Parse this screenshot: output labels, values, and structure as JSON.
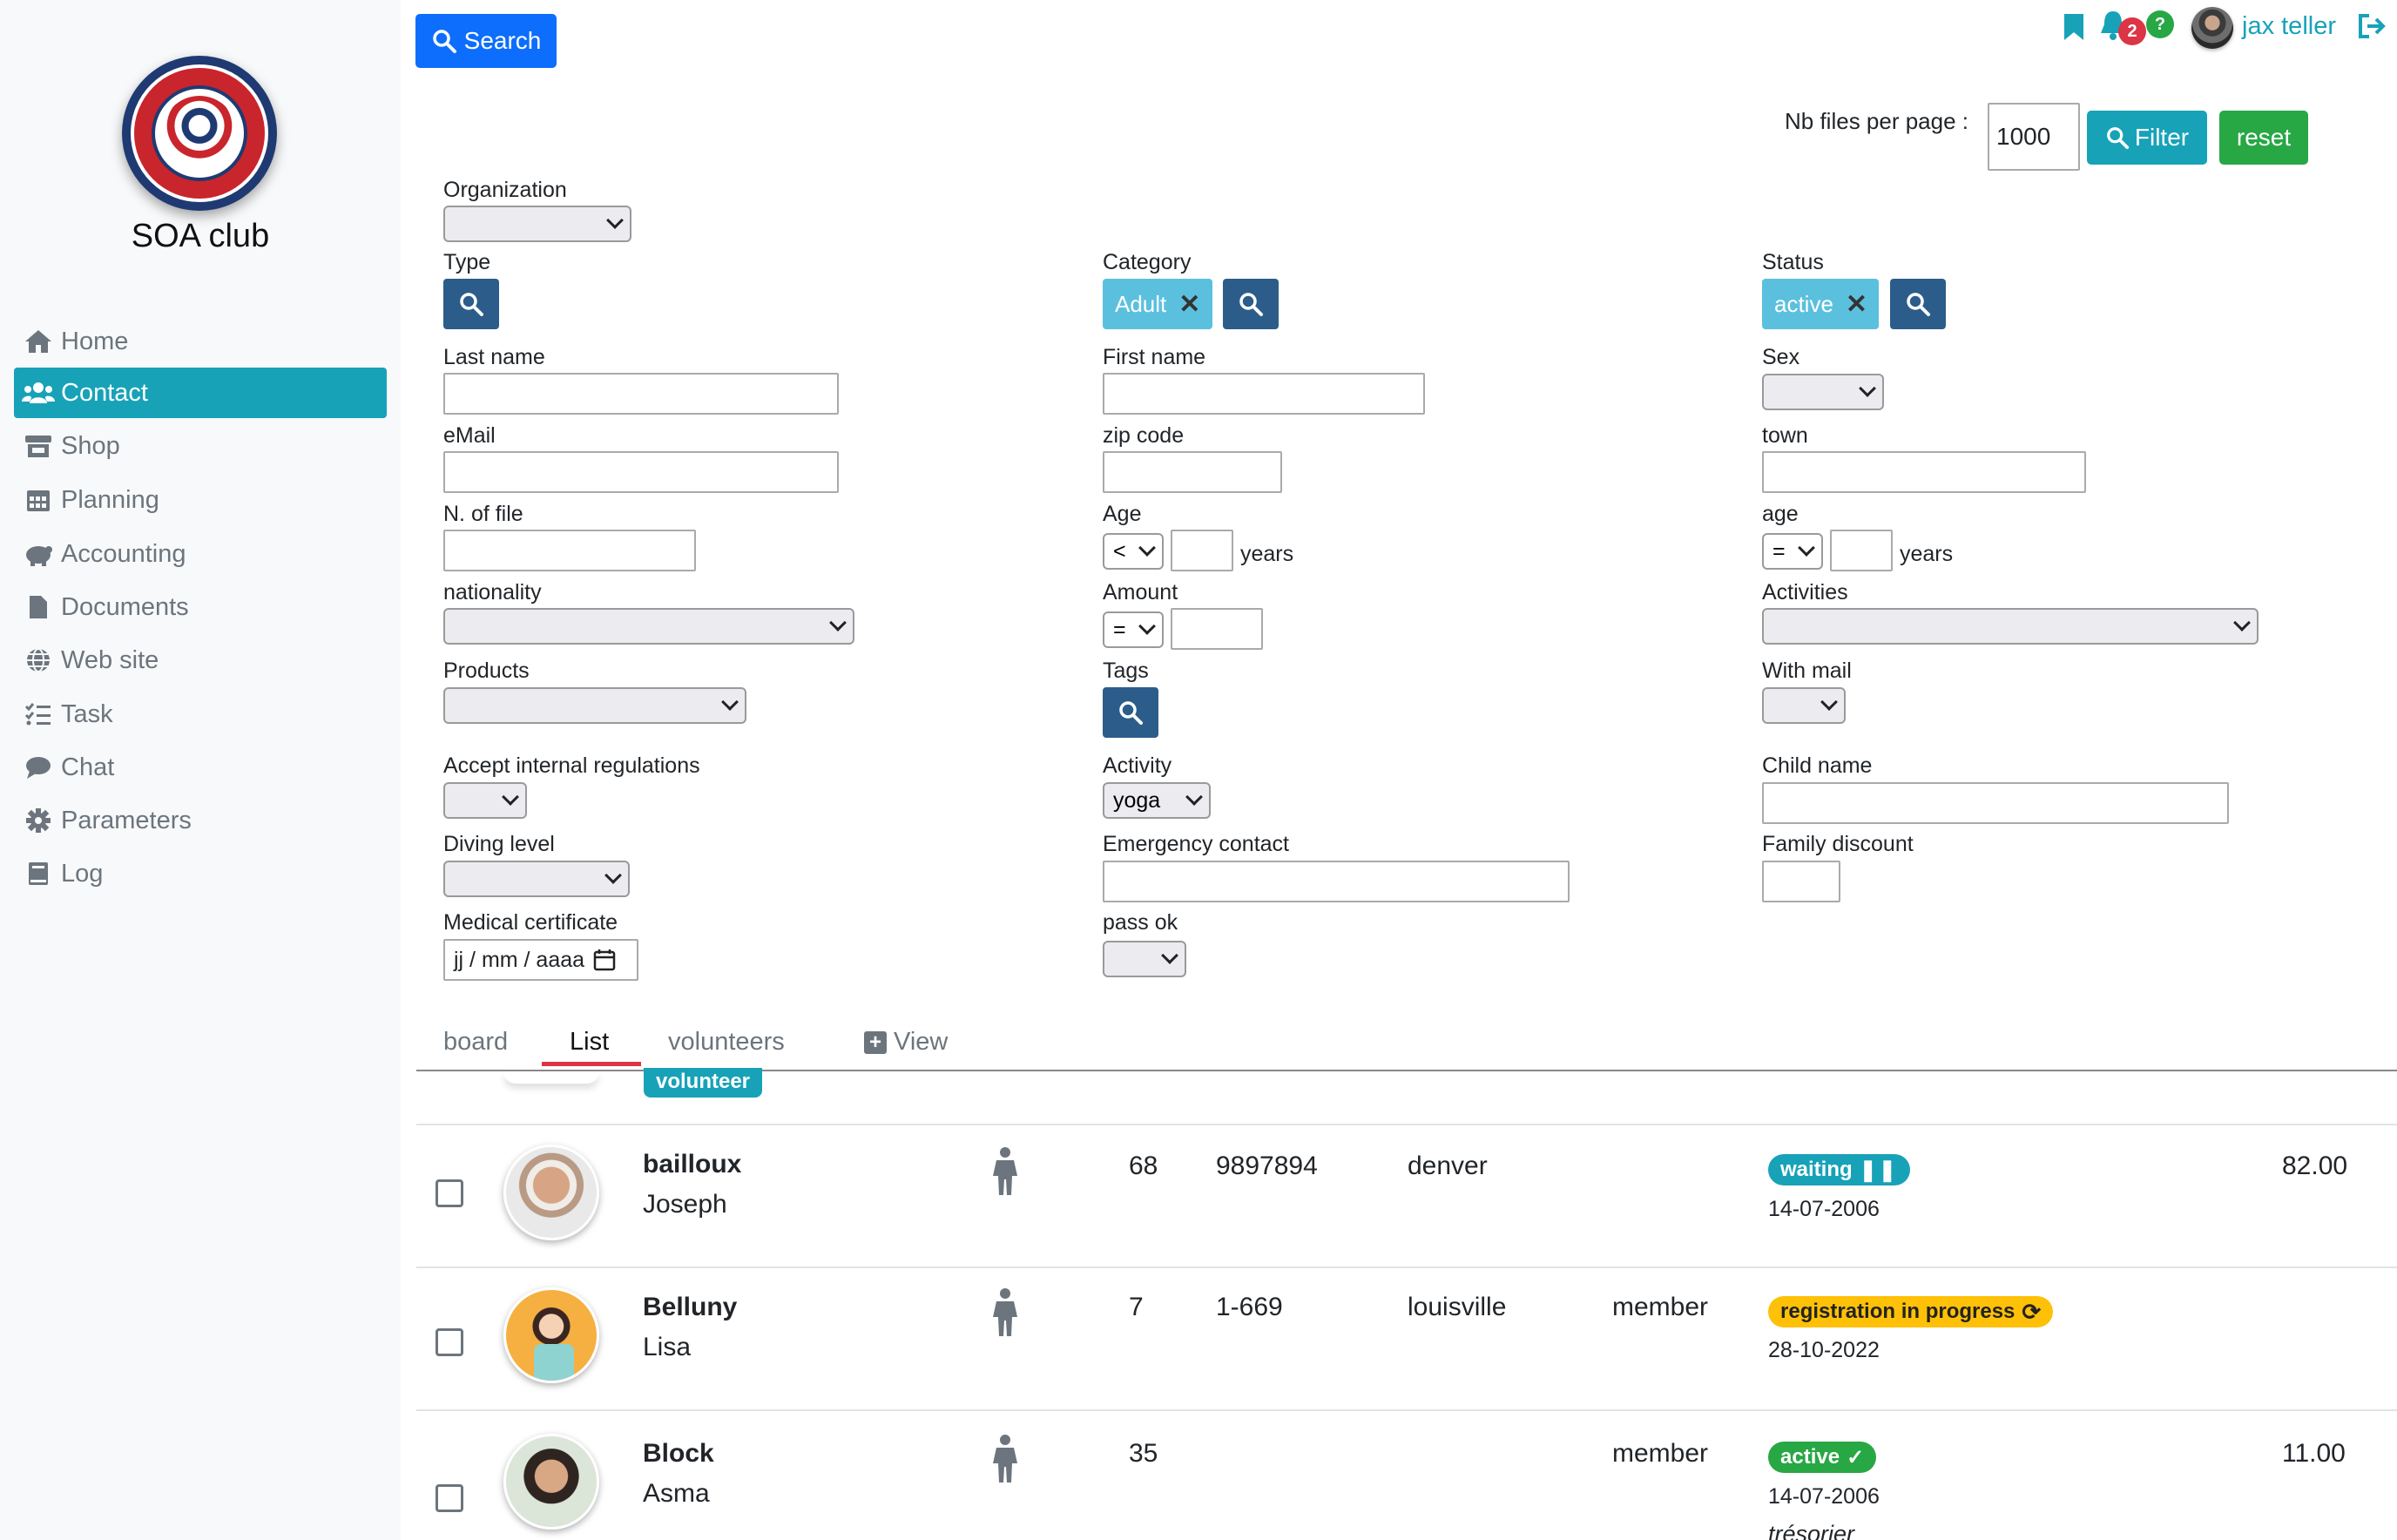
{
  "sidebar": {
    "club_name": "SOA club",
    "items": [
      {
        "label": "Home",
        "icon": "home-icon"
      },
      {
        "label": "Contact",
        "icon": "users-icon",
        "active": true
      },
      {
        "label": "Shop",
        "icon": "shop-icon"
      },
      {
        "label": "Planning",
        "icon": "calendar-icon"
      },
      {
        "label": "Accounting",
        "icon": "piggy-bank-icon"
      },
      {
        "label": "Documents",
        "icon": "file-icon"
      },
      {
        "label": "Web site",
        "icon": "globe-icon"
      },
      {
        "label": "Task",
        "icon": "tasks-icon"
      },
      {
        "label": "Chat",
        "icon": "chat-icon"
      },
      {
        "label": "Parameters",
        "icon": "gear-icon"
      },
      {
        "label": "Log",
        "icon": "book-icon"
      }
    ]
  },
  "topbar": {
    "search_label": "Search",
    "notifications_count": "2",
    "help_label": "?",
    "user_name": "jax teller",
    "nb_files_label": "Nb files per page :",
    "nb_files_value": "1000",
    "filter_label": "Filter",
    "reset_label": "reset"
  },
  "filters": {
    "organization": {
      "label": "Organization",
      "value": ""
    },
    "type": {
      "label": "Type"
    },
    "category": {
      "label": "Category",
      "tag": "Adult"
    },
    "status": {
      "label": "Status",
      "tag": "active"
    },
    "last_name": {
      "label": "Last name",
      "value": ""
    },
    "first_name": {
      "label": "First name",
      "value": ""
    },
    "sex": {
      "label": "Sex",
      "value": ""
    },
    "email": {
      "label": "eMail",
      "value": ""
    },
    "zip_code": {
      "label": "zip code",
      "value": ""
    },
    "town": {
      "label": "town",
      "value": ""
    },
    "n_of_file": {
      "label": "N. of file",
      "value": ""
    },
    "age1": {
      "label": "Age",
      "operator": "<",
      "value": "",
      "unit": "years"
    },
    "age2": {
      "label": "age",
      "operator": "=",
      "value": "",
      "unit": "years"
    },
    "nationality": {
      "label": "nationality",
      "value": ""
    },
    "amount": {
      "label": "Amount",
      "operator": "=",
      "value": ""
    },
    "activities": {
      "label": "Activities",
      "value": ""
    },
    "products": {
      "label": "Products",
      "value": ""
    },
    "tags": {
      "label": "Tags"
    },
    "with_mail": {
      "label": "With mail",
      "value": ""
    },
    "accept_regulations": {
      "label": "Accept internal regulations",
      "value": ""
    },
    "activity": {
      "label": "Activity",
      "value": "yoga"
    },
    "child_name": {
      "label": "Child name",
      "value": ""
    },
    "diving_level": {
      "label": "Diving level",
      "value": ""
    },
    "emergency_contact": {
      "label": "Emergency contact",
      "value": ""
    },
    "family_discount": {
      "label": "Family discount",
      "value": ""
    },
    "medical_certificate": {
      "label": "Medical certificate",
      "placeholder": "jj / mm / aaaa"
    },
    "pass_ok": {
      "label": "pass ok",
      "value": ""
    }
  },
  "tabs": {
    "board": "board",
    "list": "List",
    "volunteers": "volunteers",
    "view": "View"
  },
  "list": {
    "partial_badge": "volunteer",
    "rows": [
      {
        "last_name": "bailloux",
        "first_name": "Joseph",
        "age": "68",
        "file": "9897894",
        "town": "denver",
        "role": "",
        "status": "waiting",
        "status_icon": "pause-icon",
        "date": "14-07-2006",
        "amount": "82.00",
        "note": ""
      },
      {
        "last_name": "Belluny",
        "first_name": "Lisa",
        "age": "7",
        "file": "1-669",
        "town": "louisville",
        "role": "member",
        "status": "registration in progress",
        "status_icon": "refresh-icon",
        "date": "28-10-2022",
        "amount": "",
        "note": ""
      },
      {
        "last_name": "Block",
        "first_name": "Asma",
        "age": "35",
        "file": "",
        "town": "",
        "role": "member",
        "status": "active",
        "status_icon": "check-icon",
        "date": "14-07-2006",
        "amount": "11.00",
        "note": "trésorier"
      }
    ]
  },
  "colors": {
    "primary": "#0d6efd",
    "info": "#17a2b8",
    "success": "#28a745",
    "warning": "#ffc107",
    "danger": "#dc3545",
    "dark_button": "#2c5d8a",
    "tag": "#5bc0de"
  }
}
